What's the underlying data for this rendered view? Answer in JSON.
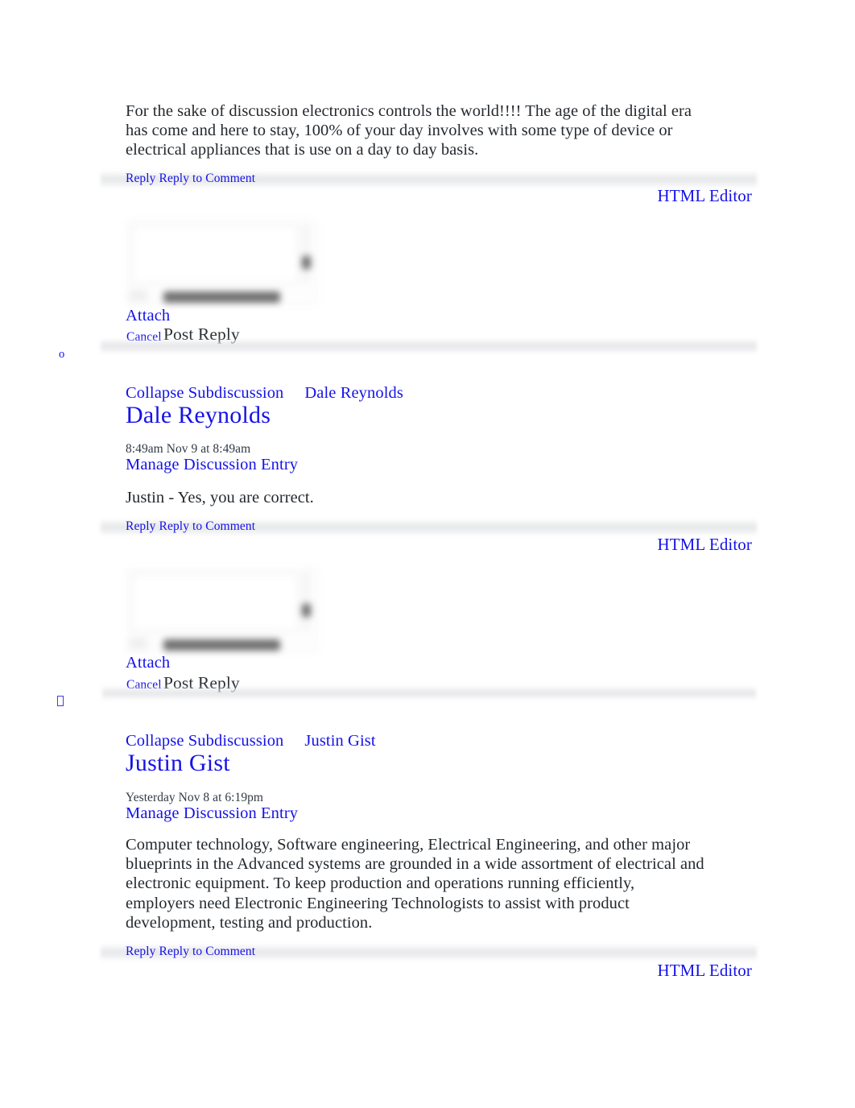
{
  "posts": [
    {
      "body": "For the sake of discussion electronics controls the world!!!! The age of the digital era has come and here to stay, 100% of your day involves with some type of device or electrical appliances that is use on a day to day basis.",
      "reply_label": "Reply",
      "reply_to_comment_label": "Reply to Comment",
      "html_editor_label": "HTML Editor",
      "attach_label": "Attach",
      "cancel_label": "Cancel",
      "post_reply_label": "Post Reply"
    },
    {
      "collapse_label": "Collapse Subdiscussion",
      "collapse_author_link": "Dale Reynolds",
      "author": "Dale Reynolds",
      "timestamp": "8:49am Nov 9 at 8:49am",
      "manage_label": "Manage Discussion Entry",
      "body": "Justin - Yes, you are correct.",
      "reply_label": "Reply",
      "reply_to_comment_label": "Reply to Comment",
      "html_editor_label": "HTML Editor",
      "attach_label": "Attach",
      "cancel_label": "Cancel",
      "post_reply_label": "Post Reply"
    },
    {
      "collapse_label": "Collapse Subdiscussion",
      "collapse_author_link": "Justin Gist",
      "author": "Justin Gist",
      "timestamp": "Yesterday Nov 8 at 6:19pm",
      "manage_label": "Manage Discussion Entry",
      "body": "Computer technology, Software engineering, Electrical Engineering, and other major blueprints in the Advanced systems are grounded in a wide assortment of electrical and electronic equipment. To keep production and operations running efficiently, employers need Electronic Engineering Technologists to assist with product development, testing and production.",
      "reply_label": "Reply",
      "reply_to_comment_label": "Reply to Comment",
      "html_editor_label": "HTML Editor"
    }
  ],
  "outline_markers": {
    "marker_1": "o",
    "marker_2": "□"
  },
  "colors": {
    "link": "#1512e8",
    "body_text": "#24292e",
    "timestamp": "#2f3a45",
    "separator": "#e0e1e4",
    "page_background": "#ffffff"
  }
}
